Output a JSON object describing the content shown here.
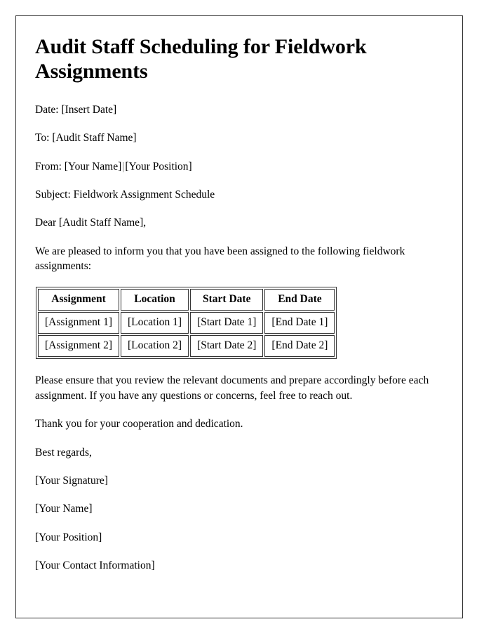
{
  "document": {
    "title": "Audit Staff Scheduling for Fieldwork Assignments",
    "meta": {
      "date_label": "Date:",
      "date_value": "[Insert Date]",
      "date_line": "Date: [Insert Date]",
      "to_line": "To: [Audit Staff Name]",
      "from_prefix": "From: [Your Name]",
      "from_separator": "|",
      "from_suffix": "[Your Position]",
      "subject_line": "Subject: Fieldwork Assignment Schedule",
      "salutation": "Dear [Audit Staff Name],"
    },
    "intro_paragraph": "We are pleased to inform you that you have been assigned to the following fieldwork assignments:",
    "table": {
      "headers": [
        "Assignment",
        "Location",
        "Start Date",
        "End Date"
      ],
      "rows": [
        [
          "[Assignment 1]",
          "[Location 1]",
          "[Start Date 1]",
          "[End Date 1]"
        ],
        [
          "[Assignment 2]",
          "[Location 2]",
          "[Start Date 2]",
          "[End Date 2]"
        ]
      ]
    },
    "closing_paragraph": "Please ensure that you review the relevant documents and prepare accordingly before each assignment. If you have any questions or concerns, feel free to reach out.",
    "thanks_paragraph": "Thank you for your cooperation and dedication.",
    "signature": {
      "regards": "Best regards,",
      "lines": [
        "[Your Signature]",
        "[Your Name]",
        "[Your Position]",
        "[Your Contact Information]"
      ]
    }
  },
  "colors": {
    "text": "#000000",
    "border": "#333333",
    "background": "#ffffff",
    "separator": "#6e6e6e"
  }
}
